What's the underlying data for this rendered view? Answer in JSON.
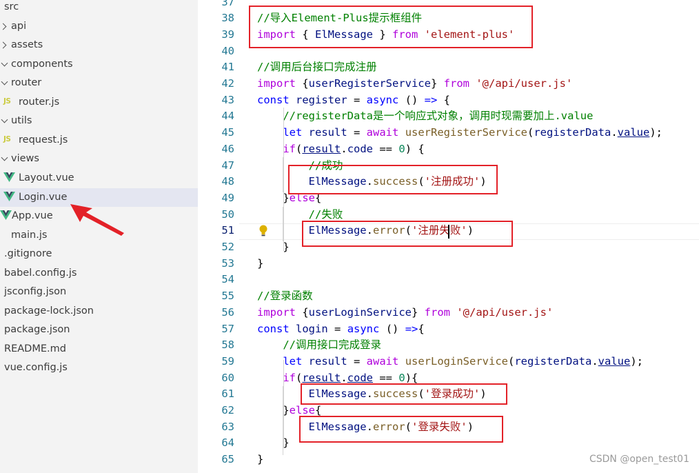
{
  "sidebar": {
    "items": [
      {
        "label": "src",
        "kind": "folder-root"
      },
      {
        "label": "api",
        "kind": "folder-collapsed"
      },
      {
        "label": "assets",
        "kind": "folder-collapsed"
      },
      {
        "label": "components",
        "kind": "folder-expanded"
      },
      {
        "label": "router",
        "kind": "folder-expanded"
      },
      {
        "label": "router.js",
        "kind": "js"
      },
      {
        "label": "utils",
        "kind": "folder-expanded"
      },
      {
        "label": "request.js",
        "kind": "js"
      },
      {
        "label": "views",
        "kind": "folder-expanded"
      },
      {
        "label": "Layout.vue",
        "kind": "vue"
      },
      {
        "label": "Login.vue",
        "kind": "vue",
        "selected": true
      },
      {
        "label": "App.vue",
        "kind": "vue"
      },
      {
        "label": "main.js",
        "kind": "js"
      },
      {
        "label": ".gitignore",
        "kind": "file"
      },
      {
        "label": "babel.config.js",
        "kind": "file"
      },
      {
        "label": "jsconfig.json",
        "kind": "file"
      },
      {
        "label": "package-lock.json",
        "kind": "file"
      },
      {
        "label": "package.json",
        "kind": "file"
      },
      {
        "label": "README.md",
        "kind": "file"
      },
      {
        "label": "vue.config.js",
        "kind": "file"
      }
    ],
    "js_icon_text": "JS",
    "icons": {
      "js": "js-file-icon",
      "vue": "vue-file-icon",
      "chevron": "chevron-icon"
    }
  },
  "editor": {
    "line_numbers": [
      "37",
      "38",
      "39",
      "40",
      "41",
      "42",
      "43",
      "44",
      "45",
      "46",
      "47",
      "48",
      "49",
      "50",
      "51",
      "52",
      "53",
      "54",
      "55",
      "56",
      "57",
      "58",
      "59",
      "60",
      "61",
      "62",
      "63",
      "64",
      "65"
    ],
    "active_line": "51",
    "lines": [
      {
        "n": "38",
        "tokens": [
          [
            "cm",
            "//导入Element-Plus提示框组件"
          ]
        ]
      },
      {
        "n": "39",
        "tokens": [
          [
            "ctl",
            "import"
          ],
          [
            "",
            " { "
          ],
          [
            "vr",
            "ElMessage"
          ],
          [
            "",
            " } "
          ],
          [
            "ctl",
            "from"
          ],
          [
            "",
            " "
          ],
          [
            "str",
            "'element-plus'"
          ]
        ]
      },
      {
        "n": "41",
        "tokens": [
          [
            "cm",
            "//调用后台接口完成注册"
          ]
        ]
      },
      {
        "n": "42",
        "tokens": [
          [
            "ctl",
            "import"
          ],
          [
            "",
            " {"
          ],
          [
            "vr",
            "userRegisterService"
          ],
          [
            "",
            "} "
          ],
          [
            "ctl",
            "from"
          ],
          [
            "",
            " "
          ],
          [
            "str",
            "'@/api/user.js'"
          ]
        ]
      },
      {
        "n": "43",
        "tokens": [
          [
            "kw",
            "const"
          ],
          [
            "",
            " "
          ],
          [
            "vr",
            "register"
          ],
          [
            "",
            " = "
          ],
          [
            "kw",
            "async"
          ],
          [
            "",
            " () "
          ],
          [
            "kw",
            "=>"
          ],
          [
            "",
            " {"
          ]
        ]
      },
      {
        "n": "44",
        "tokens": [
          [
            "",
            "    "
          ],
          [
            "cm",
            "//registerData是一个响应式对象，调用时现需要加上.value"
          ]
        ]
      },
      {
        "n": "45",
        "tokens": [
          [
            "",
            "    "
          ],
          [
            "kw",
            "let"
          ],
          [
            "",
            " "
          ],
          [
            "vr",
            "result"
          ],
          [
            "",
            " = "
          ],
          [
            "ctl",
            "await"
          ],
          [
            "",
            " "
          ],
          [
            "fn",
            "userRegisterService"
          ],
          [
            "",
            "("
          ],
          [
            "vr",
            "registerData"
          ],
          [
            "",
            "."
          ],
          [
            "vr ul",
            "value"
          ],
          [
            "",
            ");"
          ]
        ]
      },
      {
        "n": "46",
        "tokens": [
          [
            "",
            "    "
          ],
          [
            "ctl",
            "if"
          ],
          [
            "",
            "("
          ],
          [
            "vr ul",
            "result"
          ],
          [
            "",
            "."
          ],
          [
            "vr",
            "code"
          ],
          [
            "",
            " == "
          ],
          [
            "num",
            "0"
          ],
          [
            "",
            ") {"
          ]
        ]
      },
      {
        "n": "47",
        "tokens": [
          [
            "",
            "        "
          ],
          [
            "cm",
            "//成功"
          ]
        ]
      },
      {
        "n": "48",
        "tokens": [
          [
            "",
            "        "
          ],
          [
            "vr",
            "ElMessage"
          ],
          [
            "",
            "."
          ],
          [
            "fn",
            "success"
          ],
          [
            "",
            "("
          ],
          [
            "str",
            "'注册成功'"
          ],
          [
            "",
            ")"
          ]
        ]
      },
      {
        "n": "49",
        "tokens": [
          [
            "",
            "    }"
          ],
          [
            "ctl",
            "else"
          ],
          [
            "",
            "{"
          ]
        ]
      },
      {
        "n": "50",
        "tokens": [
          [
            "",
            "        "
          ],
          [
            "cm",
            "//失败"
          ]
        ]
      },
      {
        "n": "51",
        "tokens": [
          [
            "",
            "        "
          ],
          [
            "vr",
            "ElMessage"
          ],
          [
            "",
            "."
          ],
          [
            "fn",
            "error"
          ],
          [
            "",
            "("
          ],
          [
            "str",
            "'注册失败'"
          ],
          [
            "",
            ")"
          ]
        ]
      },
      {
        "n": "52",
        "tokens": [
          [
            "",
            "    }"
          ]
        ]
      },
      {
        "n": "53",
        "tokens": [
          [
            "",
            "}"
          ]
        ]
      },
      {
        "n": "55",
        "tokens": [
          [
            "cm",
            "//登录函数"
          ]
        ]
      },
      {
        "n": "56",
        "tokens": [
          [
            "ctl",
            "import"
          ],
          [
            "",
            " {"
          ],
          [
            "vr",
            "userLoginService"
          ],
          [
            "",
            "} "
          ],
          [
            "ctl",
            "from"
          ],
          [
            "",
            " "
          ],
          [
            "str",
            "'@/api/user.js'"
          ]
        ]
      },
      {
        "n": "57",
        "tokens": [
          [
            "kw",
            "const"
          ],
          [
            "",
            " "
          ],
          [
            "vr",
            "login"
          ],
          [
            "",
            " = "
          ],
          [
            "kw",
            "async"
          ],
          [
            "",
            " () "
          ],
          [
            "kw",
            "=>"
          ],
          [
            "",
            "{"
          ]
        ]
      },
      {
        "n": "58",
        "tokens": [
          [
            "",
            "    "
          ],
          [
            "cm",
            "//调用接口完成登录"
          ]
        ]
      },
      {
        "n": "59",
        "tokens": [
          [
            "",
            "    "
          ],
          [
            "kw",
            "let"
          ],
          [
            "",
            " "
          ],
          [
            "vr",
            "result"
          ],
          [
            "",
            " = "
          ],
          [
            "ctl",
            "await"
          ],
          [
            "",
            " "
          ],
          [
            "fn",
            "userLoginService"
          ],
          [
            "",
            "("
          ],
          [
            "vr",
            "registerData"
          ],
          [
            "",
            "."
          ],
          [
            "vr ul",
            "value"
          ],
          [
            "",
            ");"
          ]
        ]
      },
      {
        "n": "60",
        "tokens": [
          [
            "",
            "    "
          ],
          [
            "ctl",
            "if"
          ],
          [
            "",
            "("
          ],
          [
            "vr ul",
            "result"
          ],
          [
            "",
            "."
          ],
          [
            "vr ul",
            "code"
          ],
          [
            "",
            " == "
          ],
          [
            "num",
            "0"
          ],
          [
            "",
            "){"
          ]
        ]
      },
      {
        "n": "61",
        "tokens": [
          [
            "",
            "        "
          ],
          [
            "vr",
            "ElMessage"
          ],
          [
            "",
            "."
          ],
          [
            "fn",
            "success"
          ],
          [
            "",
            "("
          ],
          [
            "str",
            "'登录成功'"
          ],
          [
            "",
            ")"
          ]
        ]
      },
      {
        "n": "62",
        "tokens": [
          [
            "",
            "    }"
          ],
          [
            "ctl",
            "else"
          ],
          [
            "",
            "{"
          ]
        ]
      },
      {
        "n": "63",
        "tokens": [
          [
            "",
            "        "
          ],
          [
            "vr",
            "ElMessage"
          ],
          [
            "",
            "."
          ],
          [
            "fn",
            "error"
          ],
          [
            "",
            "("
          ],
          [
            "str",
            "'登录失败'"
          ],
          [
            "",
            ")"
          ]
        ]
      },
      {
        "n": "64",
        "tokens": [
          [
            "",
            "    }"
          ]
        ]
      },
      {
        "n": "65",
        "tokens": [
          [
            "",
            "}"
          ]
        ]
      }
    ],
    "colors": {
      "annotation": "#e32128",
      "line_number": "#237893",
      "keyword": "#0000ff",
      "control": "#af00db",
      "string": "#a31515",
      "comment": "#008000",
      "function": "#795e26",
      "variable": "#001080"
    },
    "icons": {
      "lightbulb": "lightbulb-icon"
    }
  },
  "watermark": "CSDN @open_test01"
}
